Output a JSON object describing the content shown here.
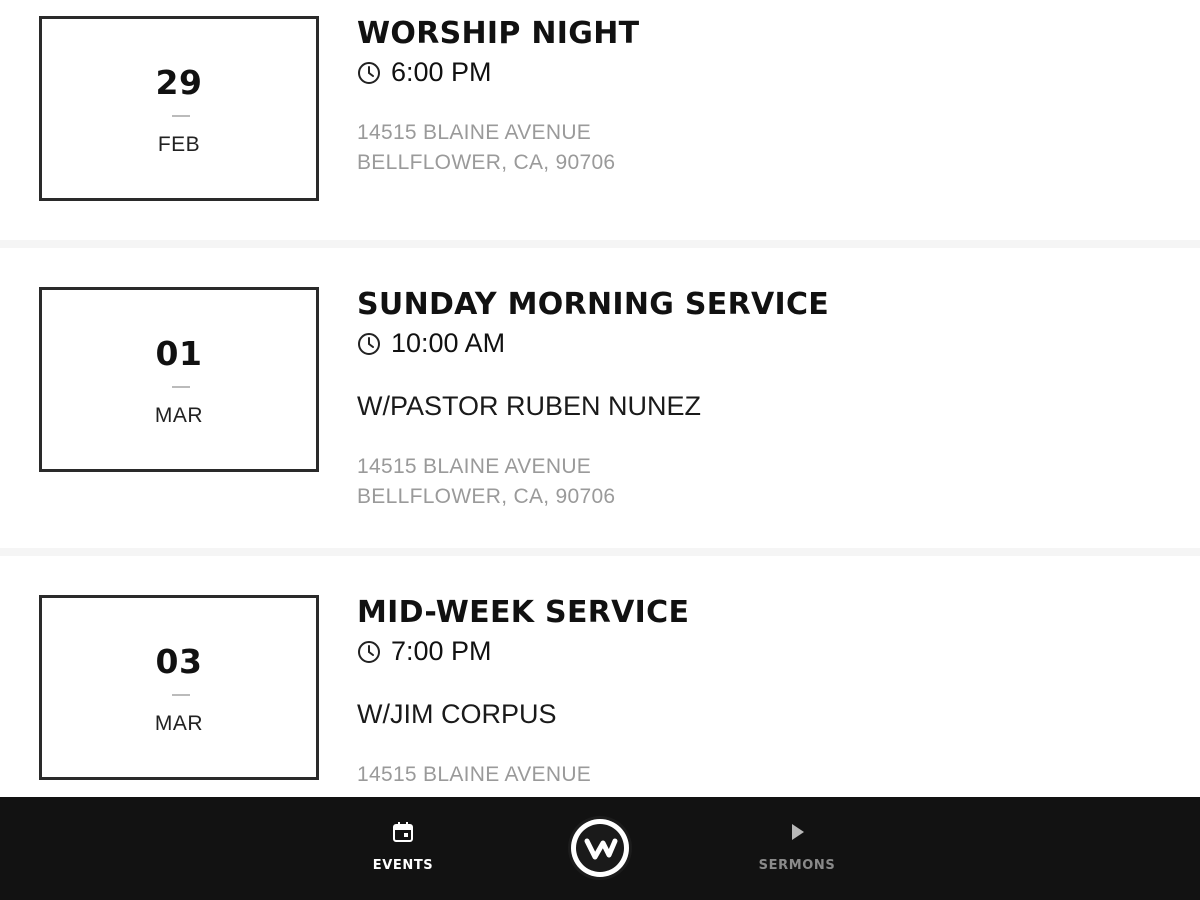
{
  "events": [
    {
      "day": "29",
      "month": "FEB",
      "title": "WORSHIP NIGHT",
      "time": "6:00 PM",
      "host": "",
      "address_line1": "14515 BLAINE AVENUE",
      "address_line2": "BELLFLOWER, CA, 90706"
    },
    {
      "day": "01",
      "month": "MAR",
      "title": "SUNDAY MORNING SERVICE",
      "time": "10:00 AM",
      "host": "W/PASTOR RUBEN NUNEZ",
      "address_line1": "14515 BLAINE AVENUE",
      "address_line2": "BELLFLOWER, CA, 90706"
    },
    {
      "day": "03",
      "month": "MAR",
      "title": "MID-WEEK SERVICE",
      "time": "7:00 PM",
      "host": "W/JIM CORPUS",
      "address_line1": "14515 BLAINE AVENUE",
      "address_line2": ""
    }
  ],
  "tabbar": {
    "events": {
      "label": "EVENTS",
      "icon": "calendar-icon",
      "active": true
    },
    "center": {
      "icon": "church-logo-icon"
    },
    "sermons": {
      "label": "SERMONS",
      "icon": "play-icon",
      "active": false
    }
  },
  "colors": {
    "tabbar_bg": "#121212",
    "tab_active": "#ffffff",
    "tab_inactive": "#8a8a8a",
    "address_text": "#9a9a9a",
    "separator": "#f5f5f5"
  }
}
